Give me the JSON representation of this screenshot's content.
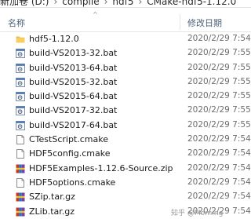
{
  "breadcrumb": [
    "新加卷 (D:)",
    "compile",
    "hdf5",
    "CMake-hdf5-1.12.0"
  ],
  "columns": {
    "name": "名称",
    "date": "修改日期"
  },
  "sort_indicator": "^",
  "files": [
    {
      "name": "hdf5-1.12.0",
      "date": "2020/2/29 7:54",
      "icon": "folder-icon"
    },
    {
      "name": "build-VS2013-32.bat",
      "date": "2020/2/29 7:55",
      "icon": "bat-file-icon"
    },
    {
      "name": "build-VS2013-64.bat",
      "date": "2020/2/29 7:55",
      "icon": "bat-file-icon"
    },
    {
      "name": "build-VS2015-32.bat",
      "date": "2020/2/29 7:55",
      "icon": "bat-file-icon"
    },
    {
      "name": "build-VS2015-64.bat",
      "date": "2020/2/29 7:55",
      "icon": "bat-file-icon"
    },
    {
      "name": "build-VS2017-32.bat",
      "date": "2020/2/29 7:55",
      "icon": "bat-file-icon"
    },
    {
      "name": "build-VS2017-64.bat",
      "date": "2020/2/29 7:55",
      "icon": "bat-file-icon"
    },
    {
      "name": "CTestScript.cmake",
      "date": "2020/2/29 7:54",
      "icon": "cmake-file-icon"
    },
    {
      "name": "HDF5config.cmake",
      "date": "2020/2/29 7:54",
      "icon": "cmake-file-icon"
    },
    {
      "name": "HDF5Examples-1.12.6-Source.zip",
      "date": "2020/2/29 7:54",
      "icon": "zip-archive-icon"
    },
    {
      "name": "HDF5options.cmake",
      "date": "2020/2/29 7:54",
      "icon": "cmake-file-icon"
    },
    {
      "name": "SZip.tar.gz",
      "date": "2020/2/29 7:54",
      "icon": "archive-icon"
    },
    {
      "name": "ZLib.tar.gz",
      "date": "2020/2/29 7:54",
      "icon": "archive-icon"
    }
  ],
  "watermark": "知乎 @Morning",
  "colors": {
    "folder": "#e8b84a",
    "header_text": "#4c607a",
    "date_text": "#6d6d6d"
  }
}
